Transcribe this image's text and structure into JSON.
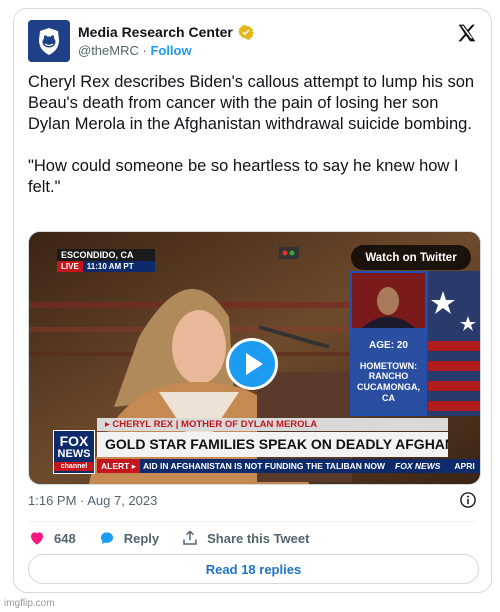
{
  "account": {
    "name": "Media Research Center",
    "handle": "@theMRC",
    "separator": " · ",
    "follow": "Follow"
  },
  "tweet": {
    "text": "Cheryl Rex describes Biden's callous attempt to lump his son Beau's death from cancer with the pain of losing her son Dylan Merola in the Afghanistan withdrawal suicide bombing.\n\n\"How could someone be so heartless to say he knew how I felt.\""
  },
  "media": {
    "location": "ESCONDIDO, CA",
    "live": "LIVE",
    "time": "11:10 AM PT",
    "watch_label": "Watch on Twitter",
    "age": "AGE: 20",
    "hometown_label": "HOMETOWN:",
    "hometown_value": "RANCHO\nCUCAMONGA, CA",
    "name_strap": "▸ CHERYL REX | MOTHER OF DYLAN MEROLA",
    "headline": "GOLD STAR FAMILIES SPEAK ON DEADLY AFGHAN EXIT",
    "alert_label": "ALERT ▸",
    "ticker": "AID IN AFGHANISTAN IS NOT FUNDING THE TALIBAN NOW",
    "ticker_logo": "FOX NEWS",
    "ticker_tail": "APRI",
    "fox_line1": "FOX",
    "fox_line2": "NEWS",
    "fox_line3": "channel"
  },
  "meta": {
    "timestamp": "1:16 PM · Aug 7, 2023"
  },
  "actions": {
    "likes": "648",
    "reply": "Reply",
    "share": "Share this Tweet"
  },
  "replies_button": "Read 18 replies",
  "watermark": "imgflip.com",
  "colors": {
    "accent": "#1d9bf0",
    "like": "#f91880",
    "fox_red": "#c4161c",
    "fox_navy": "#0d2b6b"
  }
}
